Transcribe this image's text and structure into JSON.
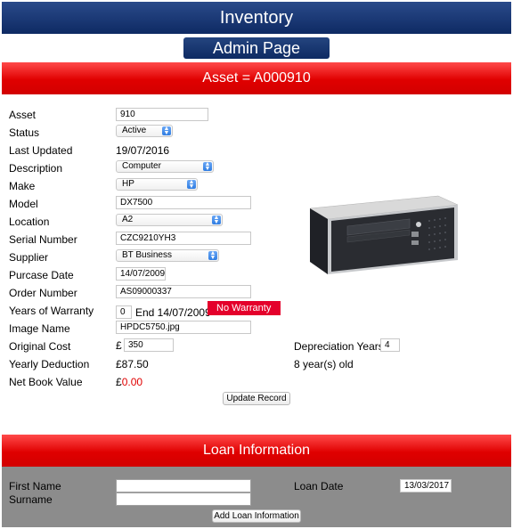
{
  "header": {
    "title": "Inventory",
    "subtitle": "Admin Page",
    "asset_banner": "Asset = A000910"
  },
  "form": {
    "asset": {
      "label": "Asset",
      "value": "910"
    },
    "status": {
      "label": "Status",
      "value": "Active"
    },
    "last_updated": {
      "label": "Last Updated",
      "value": "19/07/2016"
    },
    "description": {
      "label": "Description",
      "value": "Computer"
    },
    "make": {
      "label": "Make",
      "value": "HP"
    },
    "model": {
      "label": "Model",
      "value": "DX7500"
    },
    "location": {
      "label": "Location",
      "value": "A2"
    },
    "serial_number": {
      "label": "Serial Number",
      "value": "CZC9210YH3"
    },
    "supplier": {
      "label": "Supplier",
      "value": "BT Business"
    },
    "purchase_date": {
      "label": "Purcase Date",
      "value": "14/07/2009"
    },
    "order_number": {
      "label": "Order Number",
      "value": "AS09000337"
    },
    "years_warranty": {
      "label": "Years of Warranty",
      "value": "0",
      "end_text": "End 14/07/2009",
      "badge": "No Warranty"
    },
    "image_name": {
      "label": "Image Name",
      "value": "HPDC5750.jpg"
    },
    "original_cost": {
      "label": "Original Cost",
      "currency": "£",
      "value": "350"
    },
    "depreciation_years": {
      "label": "Depreciation Years",
      "value": "4"
    },
    "yearly_deduction": {
      "label": "Yearly Deduction",
      "value": "£87.50"
    },
    "age_text": "8 year(s) old",
    "net_book_value": {
      "label": "Net Book Value",
      "currency": "£",
      "value": "0.00"
    },
    "update_button": "Update Record"
  },
  "loan": {
    "banner": "Loan Information",
    "first_name": {
      "label": "First Name",
      "value": ""
    },
    "surname": {
      "label": "Surname",
      "value": ""
    },
    "loan_date": {
      "label": "Loan Date",
      "value": "13/03/2017"
    },
    "add_button": "Add Loan Information"
  },
  "colors": {
    "navy": "#0e2a63",
    "red": "#e00000",
    "loan_bg": "#8c8c8c",
    "select_arrow": "#2f7de2"
  },
  "icons": {
    "select_arrow": "chevron-updown-icon"
  }
}
